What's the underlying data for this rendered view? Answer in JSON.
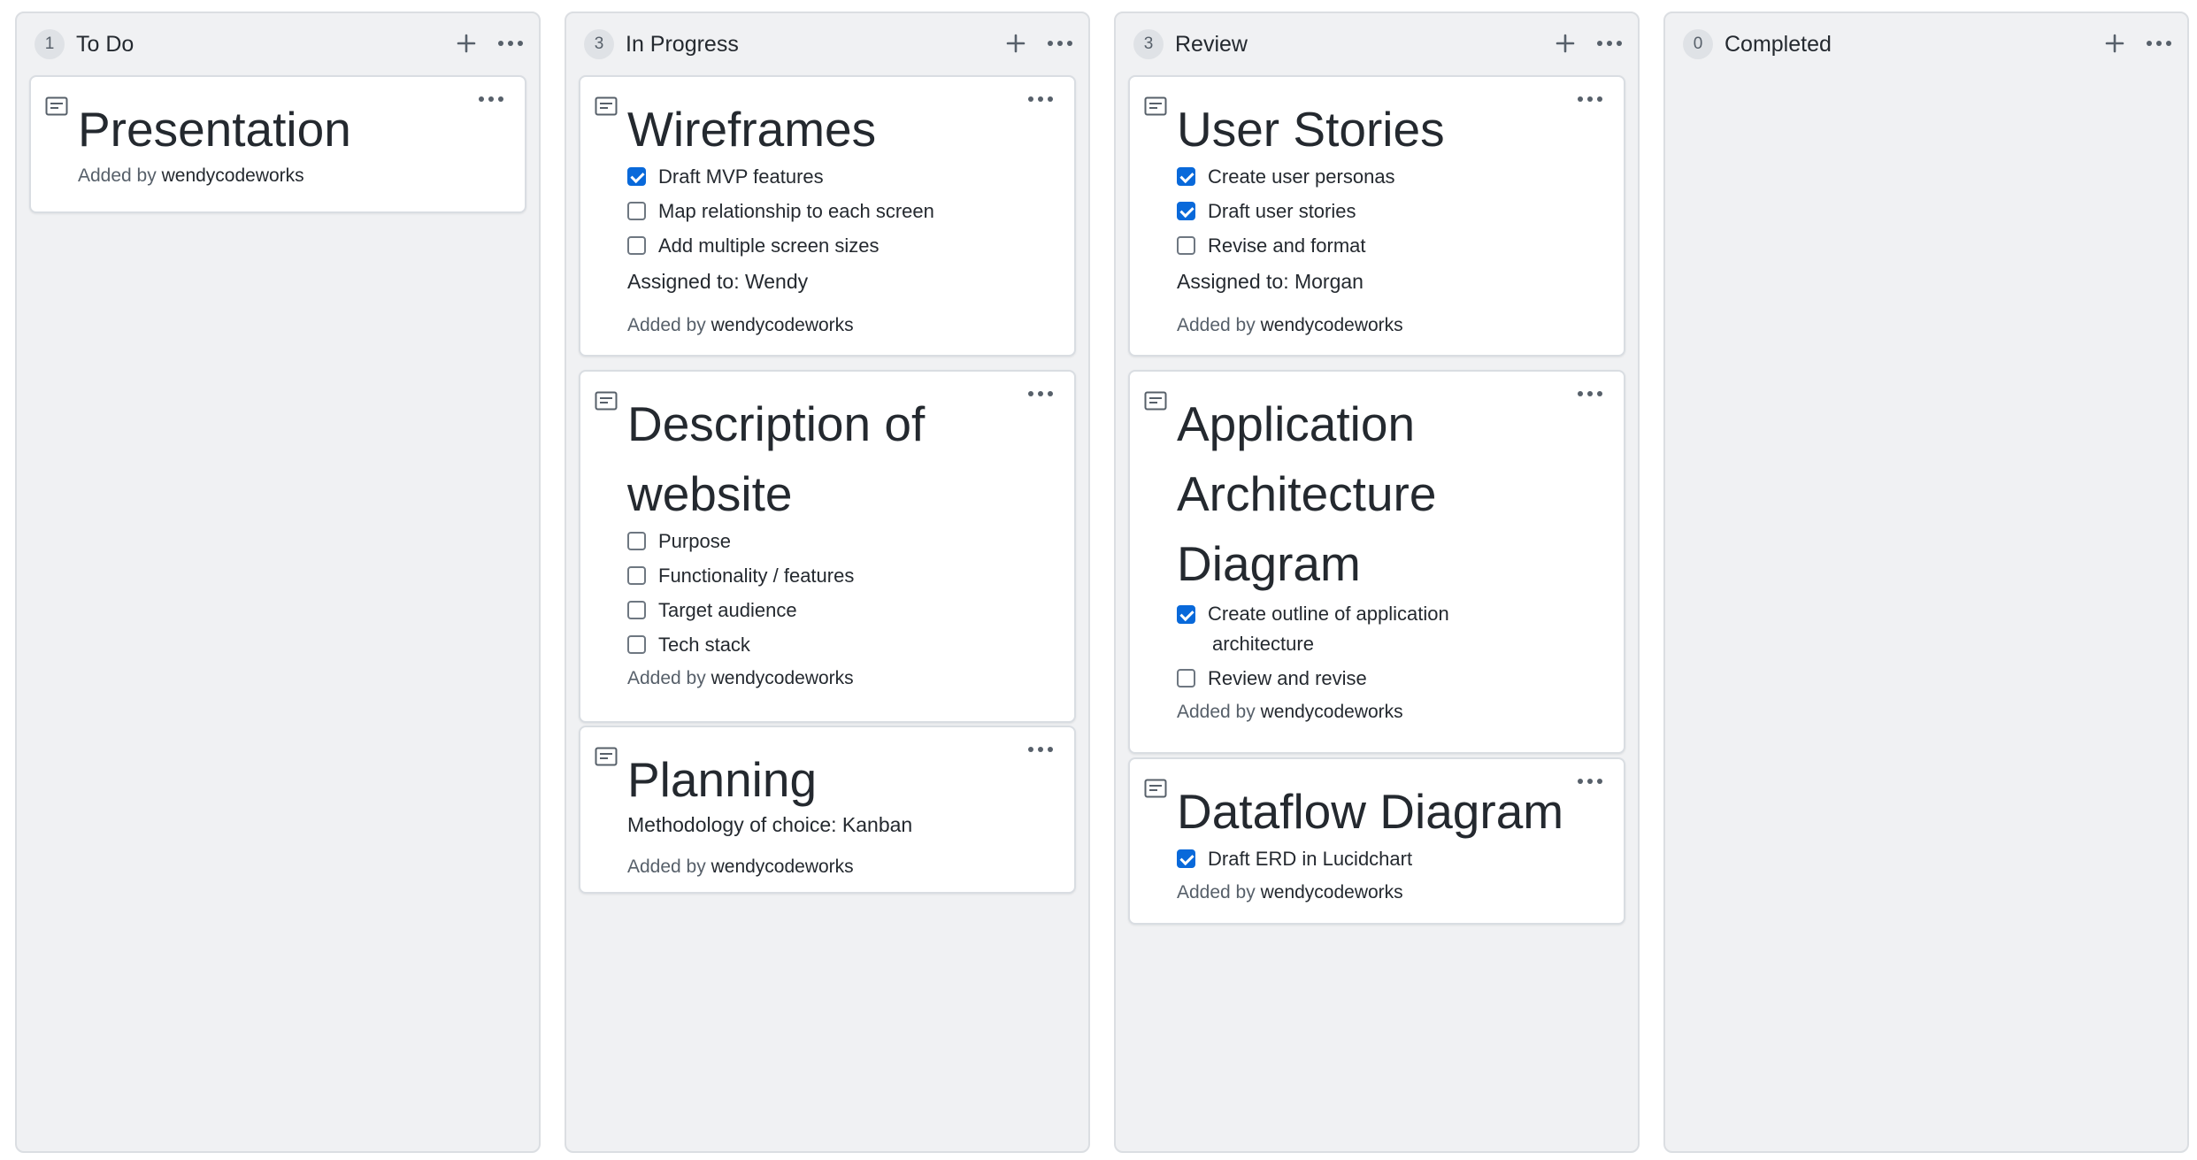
{
  "columns": [
    {
      "count": "1",
      "title": "To Do",
      "cards": [
        {
          "title": "Presentation",
          "added_prefix": "Added by",
          "added_user": "wendycodeworks"
        }
      ]
    },
    {
      "count": "3",
      "title": "In Progress",
      "cards": [
        {
          "title": "Wireframes",
          "items": [
            {
              "text": "Draft MVP features",
              "checked": true
            },
            {
              "text": "Map relationship to each screen",
              "checked": false
            },
            {
              "text": "Add multiple screen sizes",
              "checked": false
            }
          ],
          "note": "Assigned to: Wendy",
          "added_prefix": "Added by",
          "added_user": "wendycodeworks"
        },
        {
          "title_line1": "Description of",
          "title_line2": "website",
          "items": [
            {
              "text": "Purpose",
              "checked": false
            },
            {
              "text": "Functionality / features",
              "checked": false
            },
            {
              "text": "Target audience",
              "checked": false
            },
            {
              "text": "Tech stack",
              "checked": false
            }
          ],
          "added_prefix": "Added by",
          "added_user": "wendycodeworks"
        },
        {
          "title": "Planning",
          "note": "Methodology of choice: Kanban",
          "added_prefix": "Added by",
          "added_user": "wendycodeworks"
        }
      ]
    },
    {
      "count": "3",
      "title": "Review",
      "cards": [
        {
          "title": "User Stories",
          "items": [
            {
              "text": "Create user personas",
              "checked": true
            },
            {
              "text": "Draft user stories",
              "checked": true
            },
            {
              "text": "Revise and format",
              "checked": false
            }
          ],
          "note": "Assigned to: Morgan",
          "added_prefix": "Added by",
          "added_user": "wendycodeworks"
        },
        {
          "title_line1": "Application",
          "title_line2": "Architecture",
          "title_line3": "Diagram",
          "items": [
            {
              "text": "Create outline of application",
              "text_cont": "architecture",
              "checked": true
            },
            {
              "text": "Review and revise",
              "checked": false
            }
          ],
          "added_prefix": "Added by",
          "added_user": "wendycodeworks"
        },
        {
          "title": "Dataflow Diagram",
          "items": [
            {
              "text": "Draft ERD in Lucidchart",
              "checked": true
            }
          ],
          "added_prefix": "Added by",
          "added_user": "wendycodeworks"
        }
      ]
    },
    {
      "count": "0",
      "title": "Completed",
      "cards": []
    }
  ],
  "colors": {
    "checkbox_checked": "#0969da",
    "column_bg": "#f0f1f3",
    "card_bg": "#ffffff"
  },
  "icons": {
    "add": "plus-icon",
    "menu": "kebab-horizontal-icon",
    "card_type": "note-icon"
  }
}
